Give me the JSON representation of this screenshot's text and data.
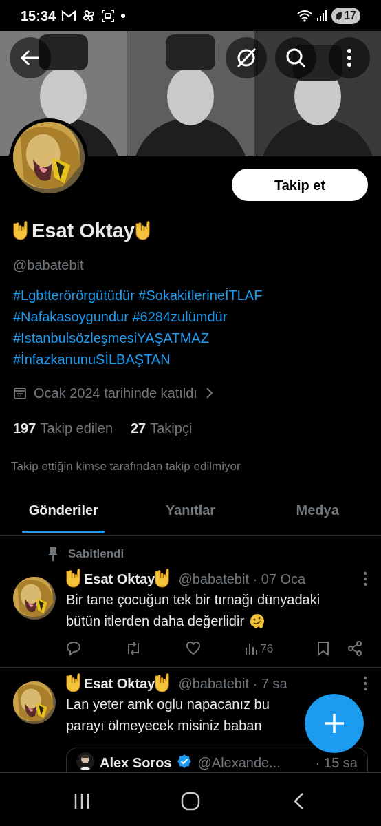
{
  "status_bar": {
    "time": "15:34",
    "battery": "17"
  },
  "profile": {
    "follow_button": "Takip et",
    "name": "Esat Oktay",
    "handle": "@babatebit",
    "bio": [
      "#Lgbtterörörgütüdür #SokakitlerineİTLAF",
      "#Nafakasoygundur #6284zulümdür",
      "#IstanbulsözleşmesiYAŞATMAZ",
      "#İnfazkanunuSİLBAŞTAN"
    ],
    "joined": "Ocak 2024 tarihinde katıldı",
    "stats": [
      {
        "count": "197",
        "label": "Takip edilen"
      },
      {
        "count": "27",
        "label": "Takipçi"
      }
    ],
    "followed_by": "Takip ettiğin kimse tarafından takip edilmiyor"
  },
  "tabs": [
    {
      "label": "Gönderiler",
      "selected": true
    },
    {
      "label": "Yanıtlar",
      "selected": false
    },
    {
      "label": "Medya",
      "selected": false
    }
  ],
  "posts": [
    {
      "pinned_label": "Sabitlendi",
      "name": "Esat Oktay",
      "meta": "@babatebit · 07 Oca",
      "lines": [
        "Bir tane çocuğun tek bir tırnağı dünyadaki",
        "bütün itlerden daha değerlidir"
      ],
      "views": "76"
    },
    {
      "name": "Esat Oktay",
      "meta": "@babatebit · 7 sa",
      "lines": [
        "Lan yeter amk oglu napacanız bu",
        "parayı ölmeyecek misiniz baban"
      ],
      "quote": {
        "name": "Alex Soros",
        "handle": "@Alexande...",
        "time": "· 15 sa"
      }
    }
  ]
}
